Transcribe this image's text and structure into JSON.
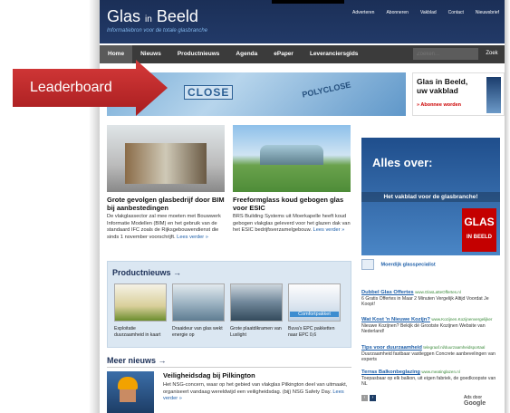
{
  "header": {
    "logo_main": "Glas",
    "logo_in": "in",
    "logo_end": "Beeld",
    "tagline": "Informatiebron voor de totale glasbranche",
    "toplinks": [
      "Adverteren",
      "Abonneren",
      "Vakblad",
      "Contact",
      "Nieuwsbrief"
    ]
  },
  "nav": {
    "items": [
      "Home",
      "Nieuws",
      "Productnieuws",
      "Agenda",
      "ePaper",
      "Leveranciersgids"
    ],
    "search_placeholder": "Zoeken...",
    "search_button": "Zoek"
  },
  "callout": {
    "label": "Leaderboard",
    "color": "#c8282b"
  },
  "leaderboard": {
    "text1": "CLOSE",
    "text2": "POLYCLOSE"
  },
  "advert": {
    "title_line1": "Glas in Beeld,",
    "title_line2": "uw vakblad",
    "link": "» Abonnee worden"
  },
  "articles": [
    {
      "title": "Grote gevolgen glasbedrijf door BIM bij aanbestedingen",
      "body": "De vlakglassector zal mee moeten met Bouwwerk Informatie Modellen (BIM) en het gebruik van de standaard IFC zoals de Rijksgebouwendienst die sinds 1 november voorschrijft.",
      "more": "Lees verder »"
    },
    {
      "title": "Freeformglass koud gebogen glas voor ESIC",
      "body": "BRS Building Systems uit Moerkapelle heeft koud gebogen vlakglas geleverd voor het glazen dak van het ESIC bedrijfsverzamelgebouw.",
      "more": "Lees verder »"
    }
  ],
  "productnieuws": {
    "title": "Productnieuws →",
    "items": [
      {
        "caption": "Exploitatie duurzaamheid in kaart"
      },
      {
        "caption": "Draaideur van glas wekt energie op"
      },
      {
        "caption": "Grote plaatdikramen van Luxlight"
      },
      {
        "caption": "Buva's EPC pakketten naar EPC 0,6",
        "badge": "Comfortpakket"
      }
    ]
  },
  "meer_nieuws": {
    "title": "Meer nieuws →",
    "item_title": "Veiligheidsdag bij Pilkington",
    "item_body": "Het NSG-concern, waar op het gebied van vlakglas Pilkington deel van uitmaakt, organiseert vandaag wereldwijd een veiligheidsdag. (bij) NSG Safety Day.",
    "item_more": "Lees verder »"
  },
  "sidebar": {
    "ad_title": "Alles over:",
    "ad_subtitle": "Het vakblad voor de glasbranche!",
    "ad_brand_1": "GLAS",
    "ad_brand_2": "IN BEELD",
    "moer": "Moerdijk glasspecialist",
    "google_ads": [
      {
        "title": "Dubbel Glas Offertes",
        "url": "www.GlasLatteOffertes.nl",
        "body": "6 Gratis Offertes in Maar 2 Minuten Vergelijk Altijd Voordat Je Koopt!"
      },
      {
        "title": "Wat Kost 'n Nieuwe Kozijn?",
        "url": "www.Kozijnen.Kozijnenvergelijker",
        "body": "Nieuwe Kozijnen? Bekijk dé Grootste Kozijnen Website van Nederland!"
      },
      {
        "title": "Tips voor duurzaamheid",
        "url": "telegraaf.nl/duurzaamheidsportaal",
        "body": "Duurzaamheid fastbaar vastleggen Concrete aanbevelingen van experts"
      },
      {
        "title": "Terras Balkonbeglazing",
        "url": "www.meatinglazen.nl",
        "body": "Toepasbaar op elk balkon, uit eigen fabriek, de goedkoopste van NL"
      }
    ],
    "ads_by": "Ads door",
    "google": "Google"
  }
}
